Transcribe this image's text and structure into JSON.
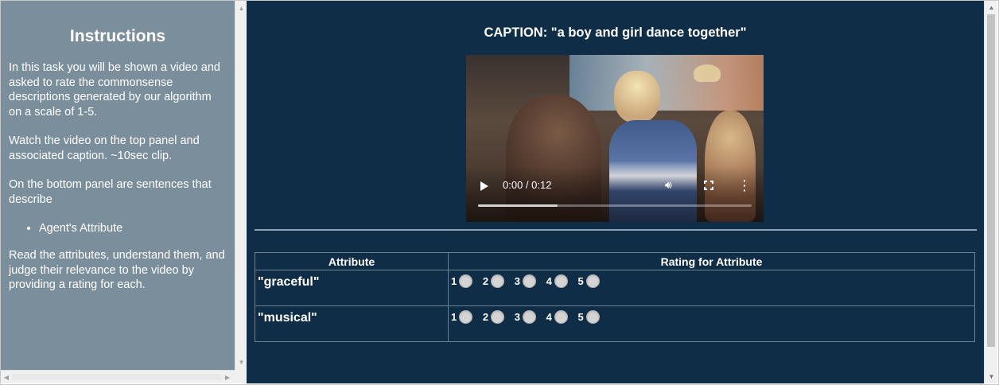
{
  "instructions": {
    "title": "Instructions",
    "para1": "In this task you will be shown a video and asked to rate the commonsense descriptions generated by our algorithm on a scale of 1-5.",
    "para2": "Watch the video on the top panel and associated caption. ~10sec clip.",
    "para3": "On the bottom panel are sentences that describe",
    "bullets": [
      "Agent's Attribute"
    ],
    "para4": "Read the attributes, understand them, and judge their relevance to the video by providing a rating for each."
  },
  "caption": "CAPTION: \"a boy and girl dance together\"",
  "video": {
    "time_display": "0:00 / 0:12",
    "progress_fraction": 0.29,
    "icons": {
      "play": "play-icon",
      "volume": "volume-icon",
      "fullscreen": "fullscreen-icon",
      "more": "more-options-icon"
    }
  },
  "table": {
    "headers": [
      "Attribute",
      "Rating for Attribute"
    ],
    "rows": [
      {
        "attribute": "\"graceful\"",
        "options": [
          "1",
          "2",
          "3",
          "4",
          "5"
        ]
      },
      {
        "attribute": "\"musical\"",
        "options": [
          "1",
          "2",
          "3",
          "4",
          "5"
        ]
      }
    ]
  },
  "colors": {
    "left_panel_bg": "#7a8e9c",
    "right_panel_bg": "#0f2d46",
    "text": "#ffffff"
  }
}
